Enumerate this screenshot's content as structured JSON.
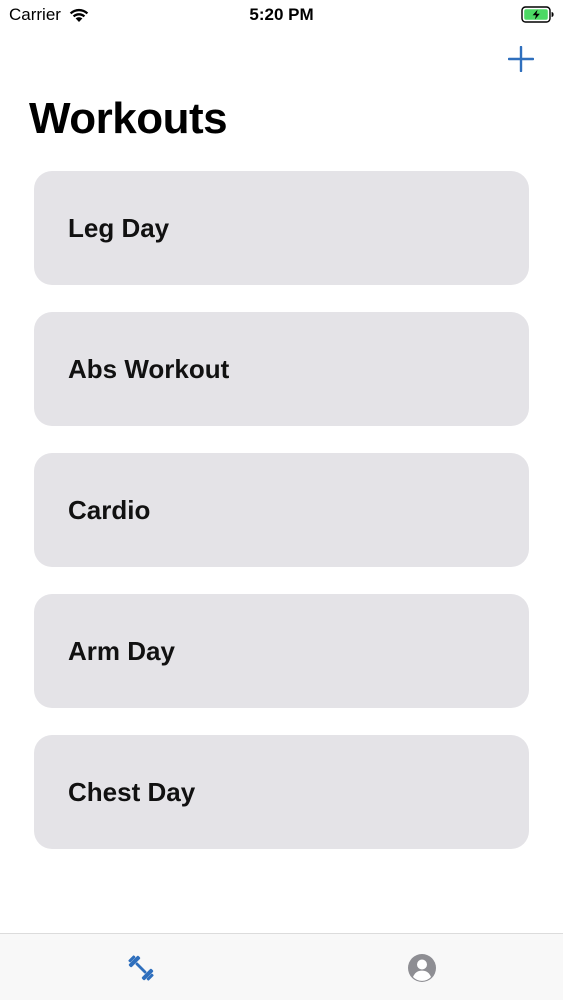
{
  "status_bar": {
    "carrier": "Carrier",
    "time": "5:20 PM",
    "icons": [
      "wifi-icon",
      "battery-charging-icon"
    ]
  },
  "navigation": {
    "title": "Workouts",
    "add_icon": "plus-icon"
  },
  "workouts": [
    {
      "name": "Leg Day"
    },
    {
      "name": "Abs Workout"
    },
    {
      "name": "Cardio"
    },
    {
      "name": "Arm Day"
    },
    {
      "name": "Chest Day"
    }
  ],
  "tab_bar": {
    "tabs": [
      {
        "icon": "dumbbell-icon",
        "selected": true
      },
      {
        "icon": "person-circle-icon",
        "selected": false
      }
    ]
  },
  "colors": {
    "accent": "#2f6fbd",
    "card_background": "#e4e3e7",
    "battery_green": "#4cd964",
    "inactive_tab": "#8e8e93"
  }
}
